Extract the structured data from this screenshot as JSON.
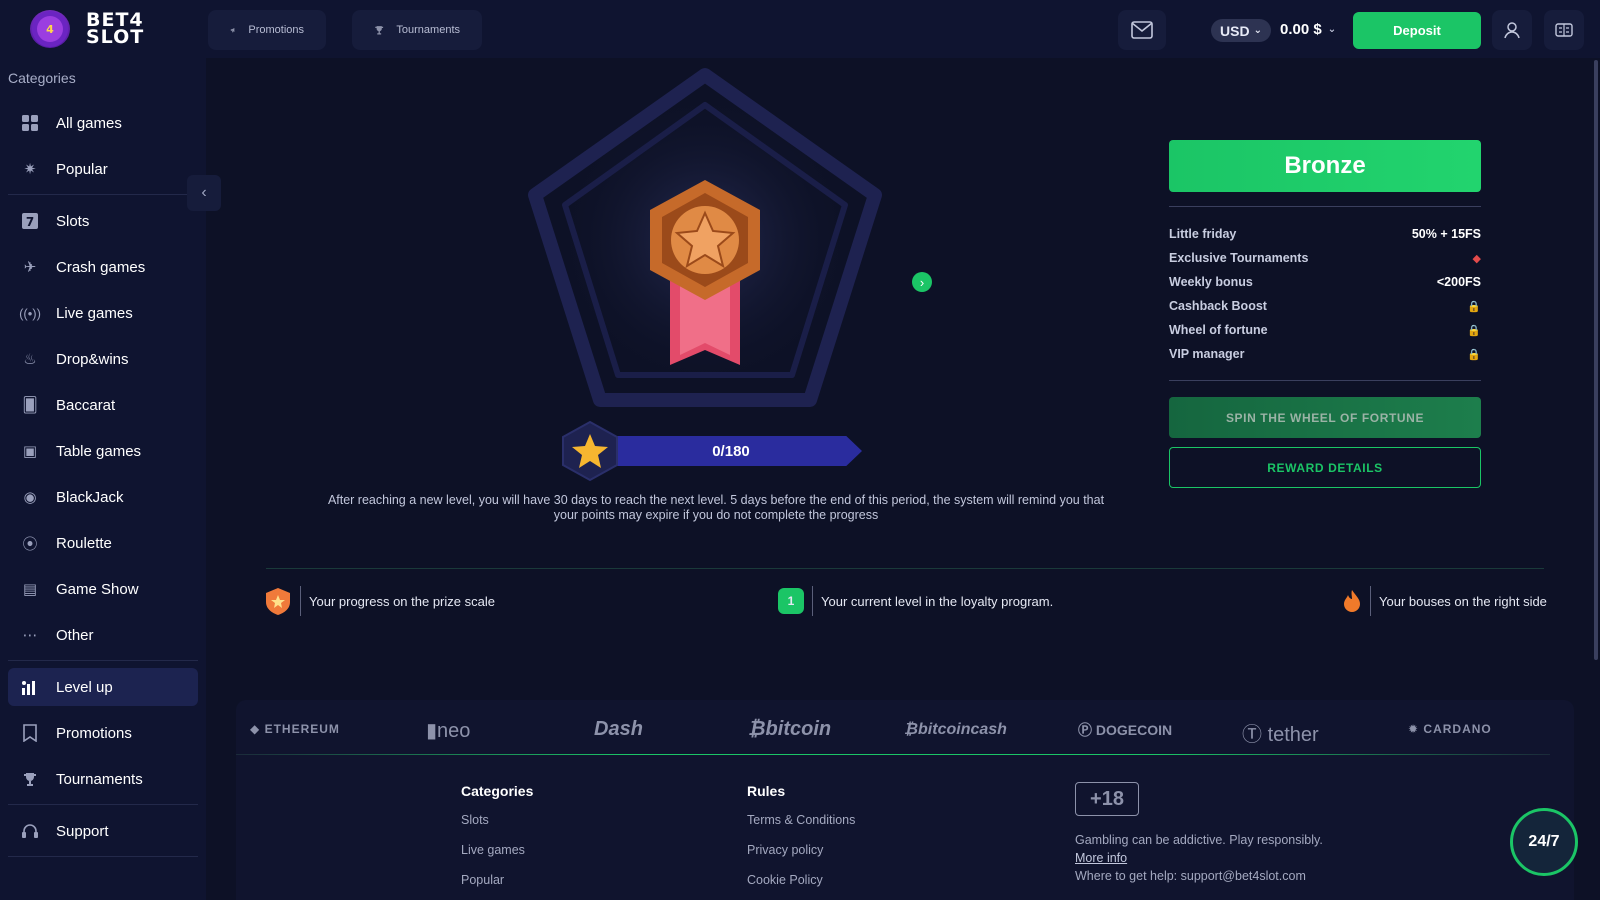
{
  "brand": {
    "logo_badge": "BET4 SLOT",
    "logo_text_line1": "BET4",
    "logo_text_line2": "SLOT"
  },
  "header": {
    "nav": [
      {
        "label": "Promotions",
        "icon": "megaphone-icon"
      },
      {
        "label": "Tournaments",
        "icon": "trophy-icon"
      }
    ],
    "currency": "USD",
    "balance": "0.00 $",
    "deposit_label": "Deposit"
  },
  "sidebar": {
    "title": "Categories",
    "items": [
      {
        "label": "All games",
        "icon": "grid-icon"
      },
      {
        "label": "Popular",
        "icon": "star-icon"
      },
      {
        "label": "Slots",
        "icon": "seven-icon"
      },
      {
        "label": "Crash games",
        "icon": "plane-icon"
      },
      {
        "label": "Live games",
        "icon": "broadcast-icon"
      },
      {
        "label": "Drop&wins",
        "icon": "drop-icon"
      },
      {
        "label": "Baccarat",
        "icon": "cards-icon"
      },
      {
        "label": "Table games",
        "icon": "dice-icon"
      },
      {
        "label": "BlackJack",
        "icon": "chip-icon"
      },
      {
        "label": "Roulette",
        "icon": "roulette-icon"
      },
      {
        "label": "Game Show",
        "icon": "show-icon"
      },
      {
        "label": "Other",
        "icon": "dots-icon"
      },
      {
        "label": "Level up",
        "icon": "chart-icon"
      },
      {
        "label": "Promotions",
        "icon": "bookmark-icon"
      },
      {
        "label": "Tournaments",
        "icon": "trophy-icon"
      },
      {
        "label": "Support",
        "icon": "headset-icon"
      }
    ]
  },
  "level": {
    "name": "Bronze",
    "progress_text": "0/180",
    "progress": 0,
    "info": "After reaching a new level, you will have 30 days to reach the next level. 5 days before the end of this period, the system will remind you that your points may expire if you do not complete the progress",
    "perks": [
      {
        "name": "Little friday",
        "value": "50% + 15FS"
      },
      {
        "name": "Exclusive Tournaments",
        "value": ""
      },
      {
        "name": "Weekly bonus",
        "value": "<200FS"
      },
      {
        "name": "Cashback Boost",
        "value": ""
      },
      {
        "name": "Wheel of fortune",
        "value": ""
      },
      {
        "name": "VIP manager",
        "value": ""
      }
    ],
    "spin_label": "SPIN THE WHEEL OF FORTUNE",
    "reward_label": "REWARD DETAILS"
  },
  "legend": [
    {
      "text": "Your progress on the prize scale"
    },
    {
      "text": "Your current level in the loyalty program.",
      "badge": "1"
    },
    {
      "text": "Your bouses on the right side"
    }
  ],
  "footer": {
    "cryptos": [
      "ETHEREUM",
      "neo",
      "Dash",
      "bitcoin",
      "bitcoincash",
      "DOGECOIN",
      "tether",
      "CARDANO"
    ],
    "categories_title": "Categories",
    "categories": [
      "Slots",
      "Live games",
      "Popular"
    ],
    "rules_title": "Rules",
    "rules": [
      "Terms & Conditions",
      "Privacy policy",
      "Cookie Policy"
    ],
    "age": "+18",
    "responsible": "Gambling can be addictive. Play responsibly.",
    "more_info": "More info",
    "help": "Where to get help: support@bet4slot.com"
  },
  "support_badge": "24/7",
  "colors": {
    "accent": "#1bc566",
    "background": "#0d1126",
    "panel": "#0f1430"
  }
}
